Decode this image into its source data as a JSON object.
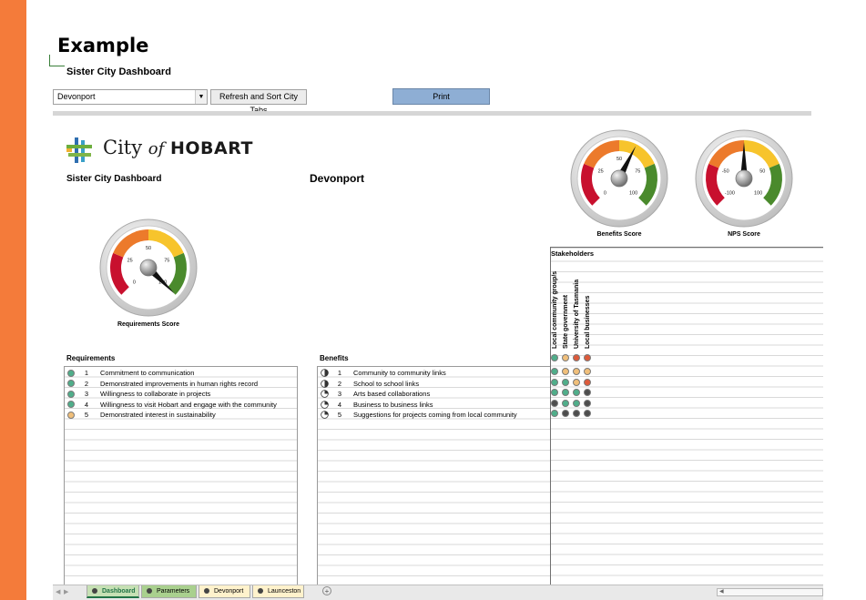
{
  "slide_title": "Example",
  "sheet_heading": "Sister City Dashboard",
  "controls": {
    "city_select_value": "Devonport",
    "refresh_button_label": "Refresh and Sort City Tabs",
    "print_button_label": "Print"
  },
  "logo": {
    "text_city": "City",
    "text_of": "of",
    "text_name": "HOBART"
  },
  "dashboard_label": "Sister City Dashboard",
  "city_name": "Devonport",
  "gauges": [
    {
      "id": "requirements",
      "caption": "Requirements Score",
      "ticks": [
        "0",
        "25",
        "50",
        "75",
        "100"
      ],
      "value": 100,
      "min": 0,
      "max": 100
    },
    {
      "id": "benefits",
      "caption": "Benefits Score",
      "ticks": [
        "0",
        "25",
        "50",
        "75",
        "100"
      ],
      "value": 60,
      "min": 0,
      "max": 100
    },
    {
      "id": "nps",
      "caption": "NPS Score",
      "ticks": [
        "-100",
        "-50",
        "0",
        "50",
        "100"
      ],
      "value": 0,
      "min": -100,
      "max": 100
    }
  ],
  "gauge_colors": {
    "red": "#c8102e",
    "orange": "#ec7a2b",
    "yellow": "#f7c42c",
    "green": "#4a8a2c"
  },
  "requirements": {
    "label": "Requirements",
    "items": [
      {
        "num": "1",
        "text": "Commitment to communication",
        "status": "green"
      },
      {
        "num": "2",
        "text": "Demonstrated improvements in human rights record",
        "status": "green"
      },
      {
        "num": "3",
        "text": "Willingness to collaborate in projects",
        "status": "green"
      },
      {
        "num": "4",
        "text": "Willingness to visit Hobart and engage with the community",
        "status": "green"
      },
      {
        "num": "5",
        "text": "Demonstrated interest in sustainability",
        "status": "amber"
      }
    ]
  },
  "benefits": {
    "label": "Benefits",
    "items": [
      {
        "num": "1",
        "text": "Community to community links",
        "harvey": 0.5
      },
      {
        "num": "2",
        "text": "School to school links",
        "harvey": 0.5
      },
      {
        "num": "3",
        "text": "Arts based collaborations",
        "harvey": 0.25
      },
      {
        "num": "4",
        "text": "Business to business links",
        "harvey": 0.25
      },
      {
        "num": "5",
        "text": "Suggestions for projects coming from local community",
        "harvey": 0.25
      }
    ]
  },
  "stakeholders": {
    "label": "Stakeholders",
    "columns": [
      "Local community group/s",
      "State government",
      "University of Tasmania",
      "Local businesses"
    ],
    "header_dots": [
      "green",
      "amber",
      "red",
      "red"
    ],
    "rows": [
      [
        "green",
        "amber",
        "amber",
        "amber"
      ],
      [
        "green",
        "green",
        "amber",
        "red"
      ],
      [
        "green",
        "green",
        "green",
        "dark"
      ],
      [
        "dark",
        "green",
        "green",
        "dark"
      ],
      [
        "green",
        "dark",
        "dark",
        "dark"
      ]
    ]
  },
  "status_colors": {
    "green": "#4fae8a",
    "amber": "#f0bf7a",
    "red": "#dd5a3a",
    "dark": "#4d4d4d"
  },
  "sheet_tabs": [
    {
      "label": "Dashboard",
      "active": true,
      "color": "#c6e0b4"
    },
    {
      "label": "Parameters",
      "active": false,
      "color": "#a9d08e"
    },
    {
      "label": "Devonport",
      "active": false,
      "color": "#fff2cc"
    },
    {
      "label": "Launceston",
      "active": false,
      "color": "#fff2cc"
    }
  ],
  "add_sheet_symbol": "+"
}
